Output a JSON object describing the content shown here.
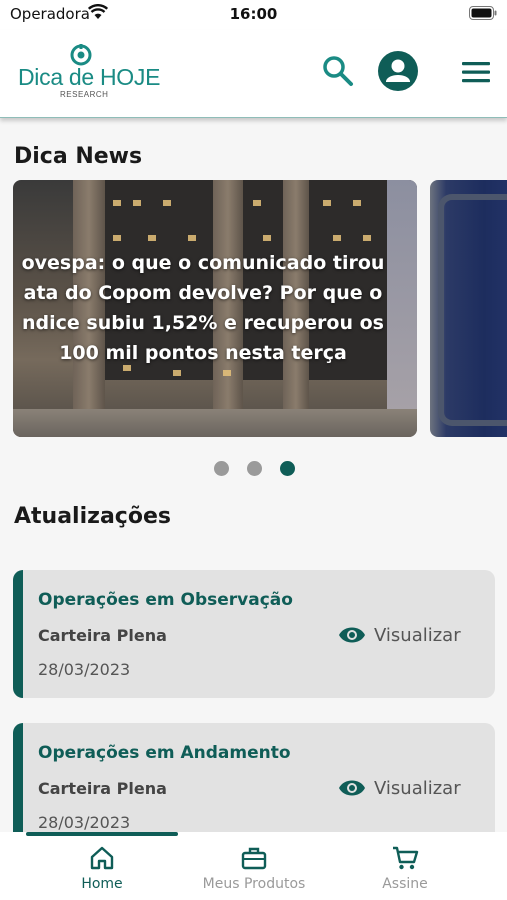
{
  "status_bar": {
    "carrier": "Operadora",
    "time": "16:00",
    "icons": [
      "wifi-icon",
      "battery-icon"
    ]
  },
  "header": {
    "logo_text": "Dica de HOJE",
    "logo_subtext": "RESEARCH",
    "actions": [
      "search-icon",
      "profile-icon",
      "menu-icon"
    ],
    "brand_color": "#1a8b84",
    "accent_color": "#0f5d57"
  },
  "news": {
    "title": "Dica News",
    "slides": [
      {
        "headline": "ovespa: o que o comunicado tirou\nata do Copom devolve? Por que o\nndice subiu 1,52% e recuperou os\n100 mil pontos nesta terça"
      },
      {
        "headline": ""
      }
    ],
    "active_dot": 3,
    "dot_count": 3
  },
  "updates": {
    "title": "Atualizações",
    "cards": [
      {
        "title": "Operações em Observação",
        "subtitle": "Carteira Plena",
        "date": "28/03/2023",
        "action_label": "Visualizar",
        "action_icon": "eye-icon"
      },
      {
        "title": "Operações em Andamento",
        "subtitle": "Carteira Plena",
        "date": "28/03/2023",
        "action_label": "Visualizar",
        "action_icon": "eye-icon"
      }
    ]
  },
  "tabs": [
    {
      "label": "Home",
      "icon": "home-icon",
      "active": true
    },
    {
      "label": "Meus Produtos",
      "icon": "briefcase-icon",
      "active": false
    },
    {
      "label": "Assine",
      "icon": "cart-icon",
      "active": false
    }
  ]
}
